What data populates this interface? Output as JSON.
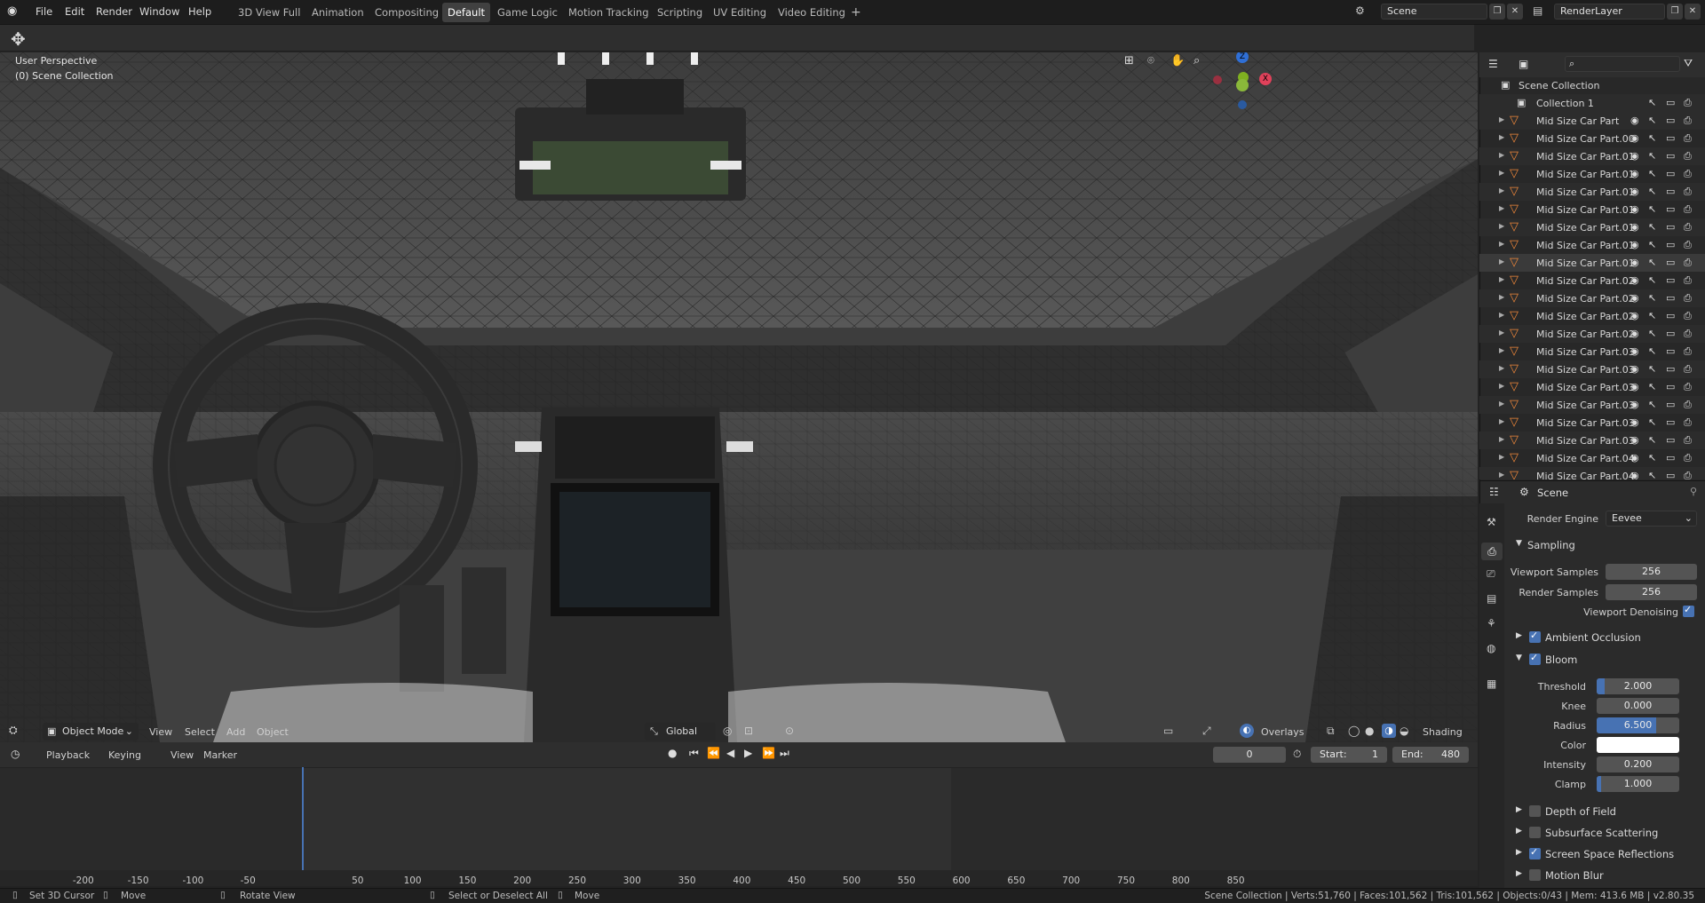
{
  "menus": [
    "File",
    "Edit",
    "Render",
    "Window",
    "Help"
  ],
  "workspaces": {
    "tabs": [
      "3D View Full",
      "Animation",
      "Compositing",
      "Default",
      "Game Logic",
      "Motion Tracking",
      "Scripting",
      "UV Editing",
      "Video Editing"
    ],
    "active": "Default",
    "add_symbol": "+"
  },
  "scene_field": "Scene",
  "renderlayer_field": "RenderLayer",
  "viewport": {
    "perspective": "User Perspective",
    "collection": "(0) Scene Collection",
    "mode": "Object Mode",
    "menus": [
      "View",
      "Select",
      "Add",
      "Object"
    ],
    "orientation": "Global",
    "overlays": "Overlays",
    "shading": "Shading",
    "gizmo": {
      "z": "Z",
      "y": "Y",
      "x": "X"
    }
  },
  "timeline": {
    "menus": [
      "Playback",
      "Keying",
      "View",
      "Marker"
    ],
    "current_frame": "0",
    "start_label": "Start:",
    "start": "1",
    "end_label": "End:",
    "end": "480",
    "ticks": [
      "-200",
      "-150",
      "-100",
      "-50",
      "0",
      "50",
      "100",
      "150",
      "200",
      "250",
      "300",
      "350",
      "400",
      "450",
      "500",
      "550",
      "600",
      "650",
      "700",
      "750",
      "800",
      "850"
    ],
    "playhead": "0"
  },
  "outliner": {
    "root": "Scene Collection",
    "collection": "Collection 1",
    "items": [
      "Mid Size Car Part",
      "Mid Size Car Part.00",
      "Mid Size Car Part.01",
      "Mid Size Car Part.01",
      "Mid Size Car Part.01",
      "Mid Size Car Part.01",
      "Mid Size Car Part.01",
      "Mid Size Car Part.01",
      "Mid Size Car Part.01",
      "Mid Size Car Part.02",
      "Mid Size Car Part.02",
      "Mid Size Car Part.02",
      "Mid Size Car Part.02",
      "Mid Size Car Part.03",
      "Mid Size Car Part.03",
      "Mid Size Car Part.03",
      "Mid Size Car Part.03",
      "Mid Size Car Part.03",
      "Mid Size Car Part.03",
      "Mid Size Car Part.04",
      "Mid Size Car Part.04"
    ],
    "selected_index": 8
  },
  "properties": {
    "context": "Scene",
    "render_engine_label": "Render Engine",
    "render_engine": "Eevee",
    "sampling": {
      "title": "Sampling",
      "viewport_samples_label": "Viewport Samples",
      "viewport_samples": "256",
      "render_samples_label": "Render Samples",
      "render_samples": "256",
      "viewport_denoising": "Viewport Denoising"
    },
    "ambient_occlusion": "Ambient Occlusion",
    "bloom": {
      "title": "Bloom",
      "threshold_label": "Threshold",
      "threshold": "2.000",
      "threshold_fill": 0.1,
      "knee_label": "Knee",
      "knee": "0.000",
      "knee_fill": 0.0,
      "radius_label": "Radius",
      "radius": "6.500",
      "radius_fill": 0.72,
      "color_label": "Color",
      "color": "#ffffff",
      "intensity_label": "Intensity",
      "intensity": "0.200",
      "intensity_fill": 0.0,
      "clamp_label": "Clamp",
      "clamp": "1.000",
      "clamp_fill": 0.05
    },
    "depth_of_field": "Depth of Field",
    "subsurface_scattering": "Subsurface Scattering",
    "screen_space_reflections": "Screen Space Reflections",
    "motion_blur": "Motion Blur"
  },
  "status": {
    "lmb": "Set 3D Cursor",
    "lmb2": "Move",
    "mmb": "Rotate View",
    "rmb": "Select or Deselect All",
    "rmb2": "Move",
    "stats": "Scene Collection | Verts:51,760 | Faces:101,562 | Tris:101,562 | Objects:0/43 | Mem: 413.6 MB | v2.80.35"
  },
  "colors": {
    "accent": "#4772b3",
    "header": "#1d1d1d",
    "panel": "#2b2b2b"
  }
}
